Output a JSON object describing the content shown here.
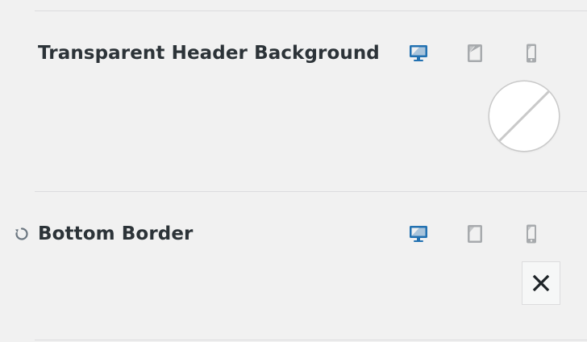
{
  "colors": {
    "accent": "#2271b1",
    "inactive": "#a7aaad",
    "text": "#2c3338",
    "reset_icon": "#6c7781",
    "close_icon": "#1d2327"
  },
  "transparent_header": {
    "title": "Transparent Header Background",
    "devices": [
      "desktop-icon",
      "tablet-icon",
      "mobile-icon"
    ],
    "active_device": "desktop",
    "color_value": "transparent"
  },
  "bottom_border": {
    "title": "Bottom Border",
    "devices": [
      "desktop-icon",
      "tablet-icon",
      "mobile-icon"
    ],
    "active_device": "desktop",
    "reset_icon": "reset-icon",
    "clear_symbol": "✕"
  }
}
